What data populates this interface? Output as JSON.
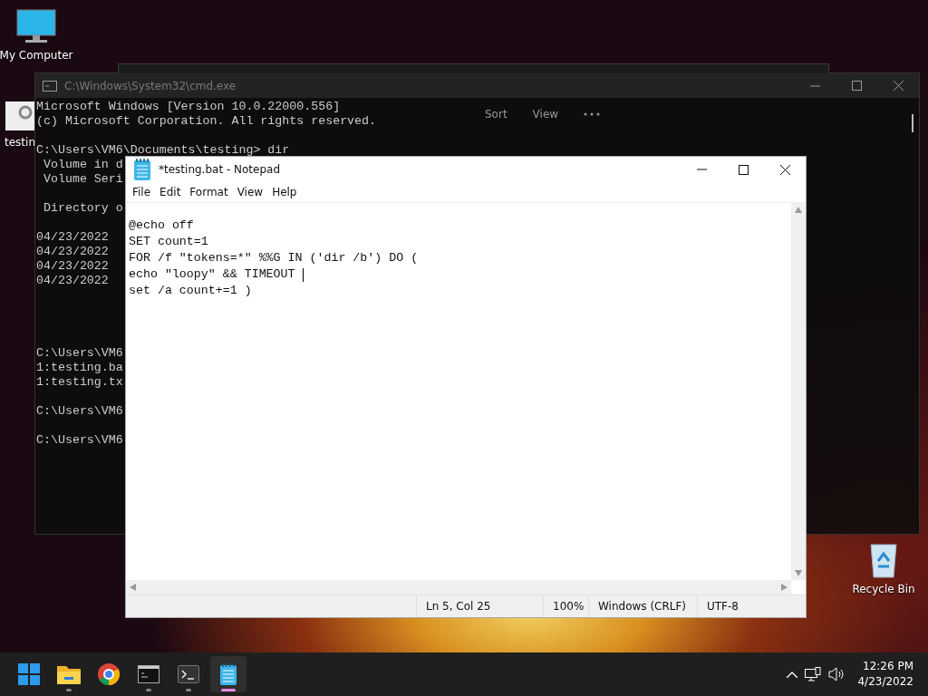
{
  "desktop_icons": [
    {
      "kind": "computer",
      "label": "My Computer"
    },
    {
      "kind": "file",
      "label": "testin"
    },
    {
      "kind": "recycle",
      "label": "Recycle Bin"
    }
  ],
  "explorer_window": {
    "toolbar": [
      "Sort",
      "View"
    ]
  },
  "cmd_window": {
    "title": "C:\\Windows\\System32\\cmd.exe",
    "blocks": [
      {
        "kind": "text",
        "lines": [
          "Microsoft Windows [Version 10.0.22000.556]",
          "(c) Microsoft Corporation. All rights reserved."
        ]
      },
      {
        "kind": "text",
        "lines": [
          "C:\\Users\\VM6\\Documents\\testing> dir",
          " Volume in d",
          " Volume Seri"
        ]
      },
      {
        "kind": "text",
        "lines": [
          " Directory o"
        ]
      },
      {
        "kind": "listing",
        "lines": [
          "04/23/2022",
          "04/23/2022",
          "04/23/2022",
          "04/23/2022"
        ]
      },
      {
        "kind": "text",
        "lines": [
          "C:\\Users\\VM6",
          "1:testing.ba",
          "1:testing.tx"
        ]
      },
      {
        "kind": "text",
        "lines": [
          "C:\\Users\\VM6"
        ]
      },
      {
        "kind": "text",
        "lines": [
          "C:\\Users\\VM6"
        ]
      }
    ]
  },
  "notepad": {
    "title": "*testing.bat - Notepad",
    "menu": [
      "File",
      "Edit",
      "Format",
      "View",
      "Help"
    ],
    "lines": [
      {
        "text": "@echo off",
        "caret": false
      },
      {
        "text": "SET count=1",
        "caret": false
      },
      {
        "text": "FOR /f \"tokens=*\" %%G IN ('dir /b') DO (",
        "caret": false
      },
      {
        "text": "echo \"loopy\" && TIMEOUT ",
        "caret": true
      },
      {
        "text": "set /a count+=1 )",
        "caret": false
      }
    ],
    "status": [
      "Ln 5, Col 25",
      "100%",
      "Windows (CRLF)",
      "UTF-8"
    ]
  },
  "taskbar": {
    "apps": [
      {
        "kind": "start",
        "running": false,
        "selected": false
      },
      {
        "kind": "folder",
        "running": true,
        "selected": false
      },
      {
        "kind": "browser",
        "running": false,
        "selected": false
      },
      {
        "kind": "console",
        "running": true,
        "selected": false
      },
      {
        "kind": "terminal",
        "running": true,
        "selected": false
      },
      {
        "kind": "notepad",
        "running": true,
        "selected": true
      }
    ],
    "time": "12:26 PM",
    "date": "4/23/2022"
  }
}
